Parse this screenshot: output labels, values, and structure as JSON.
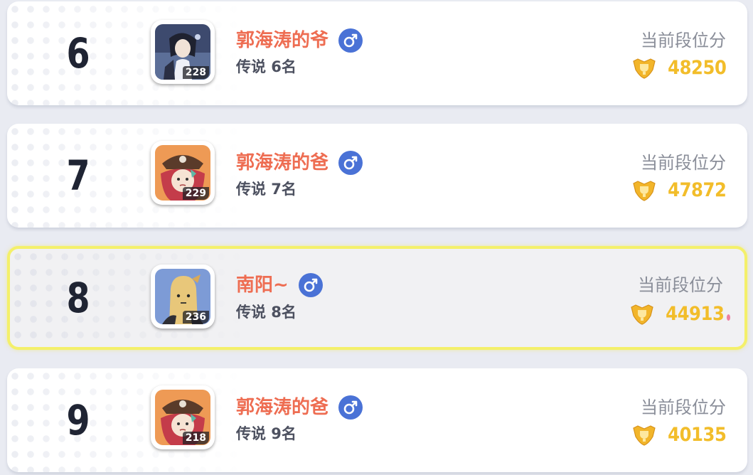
{
  "score_label": "当前段位分",
  "colors": {
    "name": "#ee6d52",
    "score": "#f2bd2a",
    "gender_badge": "#4a72d6",
    "highlight_border": "#f4f06a"
  },
  "entries": [
    {
      "rank": "6",
      "name": "郭海涛的爷",
      "gender": "male-icon",
      "title": "传说 6名",
      "level": "228",
      "score": "48250",
      "avatar": "anime-character-dark-hair",
      "highlight": false
    },
    {
      "rank": "7",
      "name": "郭海涛的爸",
      "gender": "male-icon",
      "title": "传说 7名",
      "level": "229",
      "score": "47872",
      "avatar": "pirate-girl-red-hair",
      "highlight": false
    },
    {
      "rank": "8",
      "name": "南阳~",
      "gender": "male-icon",
      "title": "传说 8名",
      "level": "236",
      "score": "44913",
      "avatar": "cartoon-bean-character",
      "highlight": true
    },
    {
      "rank": "9",
      "name": "郭海涛的爸",
      "gender": "male-icon",
      "title": "传说 9名",
      "level": "218",
      "score": "40135",
      "avatar": "pirate-girl-red-hair",
      "highlight": false
    }
  ]
}
